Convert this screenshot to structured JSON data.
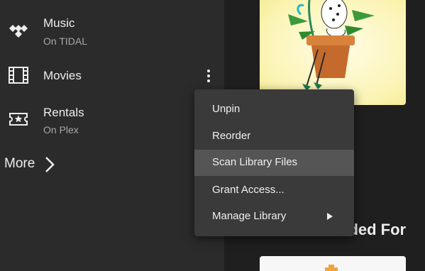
{
  "sidebar": {
    "items": [
      {
        "title": "Music",
        "subtitle": "On TIDAL",
        "icon": "tidal-icon"
      },
      {
        "title": "Movies",
        "subtitle": "",
        "icon": "film-icon"
      },
      {
        "title": "Rentals",
        "subtitle": "On Plex",
        "icon": "ticket-icon"
      }
    ],
    "more_label": "More"
  },
  "main": {
    "section_heading": "nded For"
  },
  "context_menu": {
    "items": [
      {
        "label": "Unpin"
      },
      {
        "label": "Reorder"
      },
      {
        "label": "Scan Library Files",
        "highlighted": true
      },
      {
        "label": "Grant Access..."
      },
      {
        "label": "Manage Library",
        "has_submenu": true
      }
    ]
  },
  "colors": {
    "sidebar_bg": "#2b2b2b",
    "main_bg": "#1f1f1f",
    "menu_bg": "#3a3a3a",
    "menu_hover": "#555555",
    "accent_yellow": "#e5a00d"
  }
}
